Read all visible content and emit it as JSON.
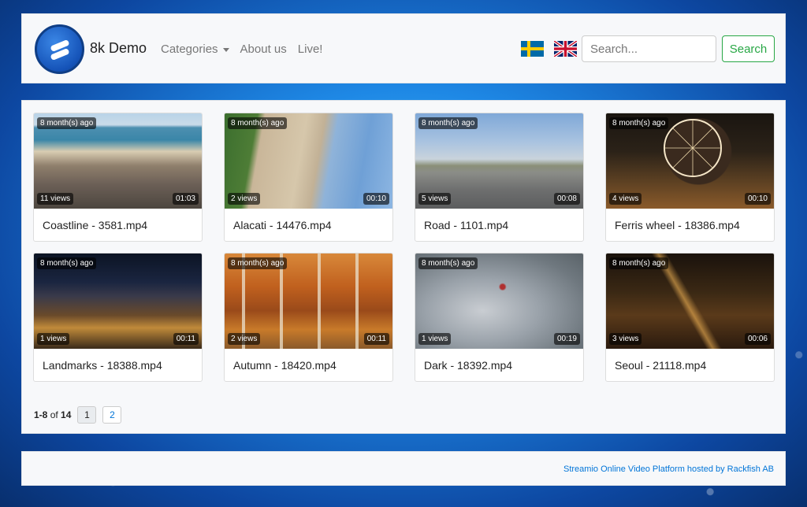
{
  "header": {
    "brand": "8k Demo",
    "nav": {
      "categories": "Categories",
      "about": "About us",
      "live": "Live!"
    },
    "search": {
      "placeholder": "Search...",
      "button": "Search"
    }
  },
  "videos": [
    {
      "age": "8 month(s) ago",
      "views": "11 views",
      "duration": "01:03",
      "title": "Coastline - 3581.mp4"
    },
    {
      "age": "8 month(s) ago",
      "views": "2 views",
      "duration": "00:10",
      "title": "Alacati - 14476.mp4"
    },
    {
      "age": "8 month(s) ago",
      "views": "5 views",
      "duration": "00:08",
      "title": "Road - 1101.mp4"
    },
    {
      "age": "8 month(s) ago",
      "views": "4 views",
      "duration": "00:10",
      "title": "Ferris wheel - 18386.mp4"
    },
    {
      "age": "8 month(s) ago",
      "views": "1 views",
      "duration": "00:11",
      "title": "Landmarks - 18388.mp4"
    },
    {
      "age": "8 month(s) ago",
      "views": "2 views",
      "duration": "00:11",
      "title": "Autumn - 18420.mp4"
    },
    {
      "age": "8 month(s) ago",
      "views": "1 views",
      "duration": "00:19",
      "title": "Dark - 18392.mp4"
    },
    {
      "age": "8 month(s) ago",
      "views": "3 views",
      "duration": "00:06",
      "title": "Seoul - 21118.mp4"
    }
  ],
  "pagination": {
    "range": "1-8",
    "of": "of",
    "total": "14",
    "pages": [
      "1",
      "2"
    ],
    "current": "1"
  },
  "footer": {
    "credit": "Streamio Online Video Platform hosted by Rackfish AB"
  },
  "colors": {
    "accent_green": "#28a745",
    "link_blue": "#0275d8",
    "logo_blue": "#1553b8"
  },
  "icons": {
    "logo": "streamio-logo-icon",
    "flag_se": "swedish-flag-icon",
    "flag_uk": "uk-flag-icon",
    "caret": "caret-down-icon"
  }
}
